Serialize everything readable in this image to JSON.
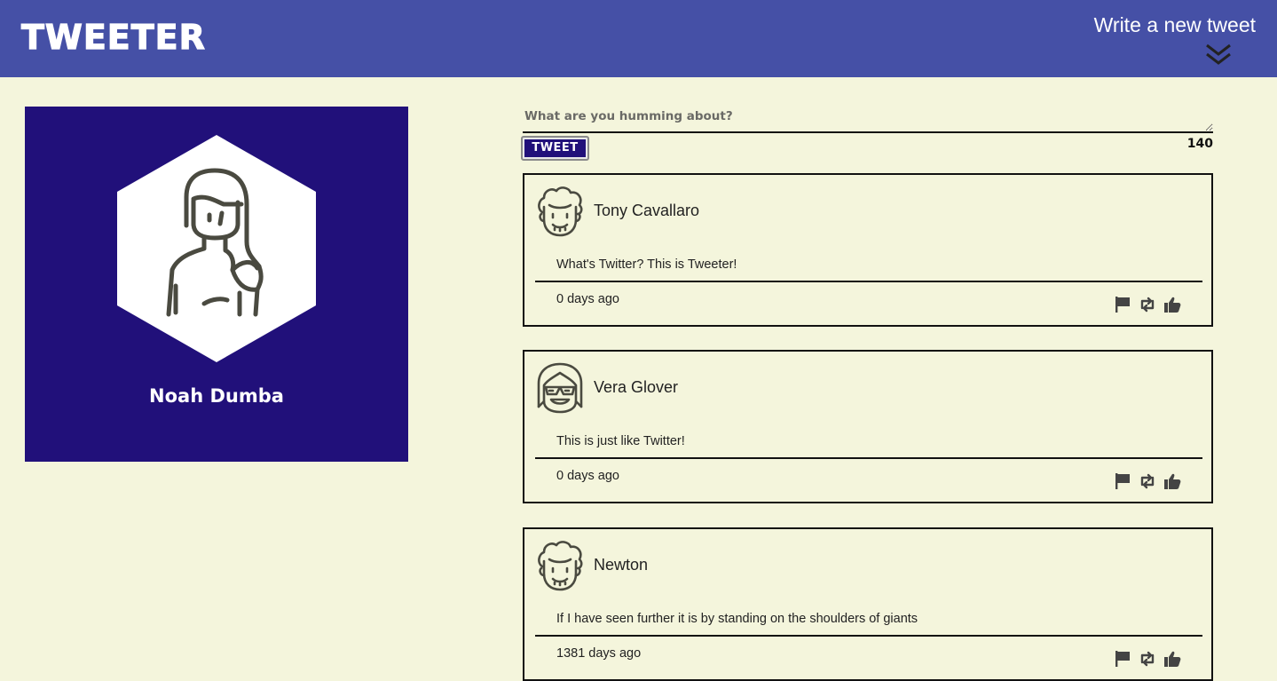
{
  "navbar": {
    "brand": "TWEETER",
    "compose_label": "Write a new tweet",
    "compose_icon": "double-chevron-down-icon"
  },
  "profile": {
    "name": "Noah Dumba",
    "avatar_icon": "woman-avatar-icon",
    "background_color": "#21107a"
  },
  "compose": {
    "placeholder": "What are you humming about?",
    "button_label": "TWEET",
    "char_count": "140"
  },
  "tweets": [
    {
      "author": "Tony Cavallaro",
      "avatar_icon": "curly-hair-man-avatar-icon",
      "text": "What's Twitter? This is Tweeter!",
      "time": "0 days ago"
    },
    {
      "author": "Vera Glover",
      "avatar_icon": "sunglasses-woman-avatar-icon",
      "text": "This is just like Twitter!",
      "time": "0 days ago"
    },
    {
      "author": "Newton",
      "avatar_icon": "curly-hair-man-avatar-icon",
      "text": "If I have seen further it is by standing on the shoulders of giants",
      "time": "1381 days ago"
    }
  ],
  "actions": [
    "flag-icon",
    "retweet-icon",
    "like-icon"
  ],
  "colors": {
    "navbar": "#4550a6",
    "page_background": "#f4f5dc",
    "accent": "#21107a"
  }
}
